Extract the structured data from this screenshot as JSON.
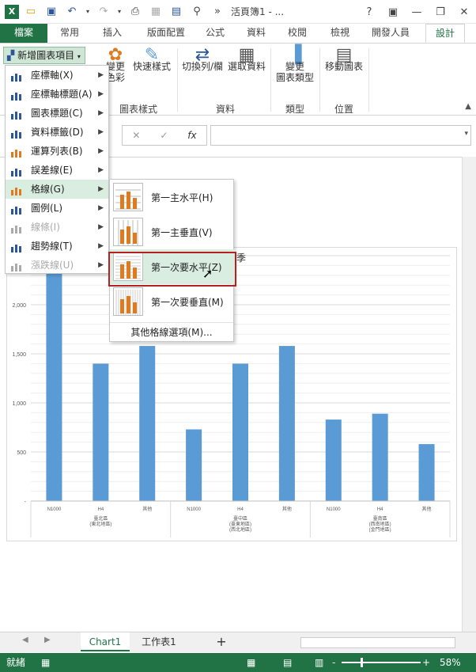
{
  "window": {
    "title": "活頁簿1 - ...",
    "help": "?",
    "min": "—",
    "restore": "❐",
    "close": "✕"
  },
  "tabs": {
    "file": "檔案",
    "home": "常用",
    "insert": "插入",
    "layout": "版面配置",
    "formulas": "公式",
    "data": "資料",
    "review": "校閱",
    "view": "檢視",
    "developer": "開發人員",
    "design": "設計"
  },
  "ribbon": {
    "add_element": "新增圖表項目",
    "change_colors": "變更\n色彩",
    "quick_styles": "快速樣式",
    "switch_row_col": "切換列/欄",
    "select_data": "選取資料",
    "change_type": "變更\n圖表類型",
    "move_chart": "移動圖表",
    "group_styles": "圖表樣式",
    "group_data": "資料",
    "group_type": "類型",
    "group_location": "位置"
  },
  "formula_bar": {
    "cancel": "✕",
    "enter": "✓",
    "fx": "fx",
    "value": ""
  },
  "menu": {
    "items": [
      {
        "label": "座標軸(X)",
        "disabled": false
      },
      {
        "label": "座標軸標題(A)",
        "disabled": false
      },
      {
        "label": "圖表標題(C)",
        "disabled": false
      },
      {
        "label": "資料標籤(D)",
        "disabled": false
      },
      {
        "label": "運算列表(B)",
        "disabled": false
      },
      {
        "label": "誤差線(E)",
        "disabled": false
      },
      {
        "label": "格線(G)",
        "disabled": false
      },
      {
        "label": "圖例(L)",
        "disabled": false
      },
      {
        "label": "線條(I)",
        "disabled": true
      },
      {
        "label": "趨勢線(T)",
        "disabled": false
      },
      {
        "label": "漲跌線(U)",
        "disabled": true
      }
    ]
  },
  "submenu": {
    "items": [
      {
        "label": "第一主水平(H)"
      },
      {
        "label": "第一主垂直(V)"
      },
      {
        "label": "第一次要水平(Z)"
      },
      {
        "label": "第一次要垂直(M)"
      }
    ],
    "more": "其他格線選項(M)..."
  },
  "chart_data": {
    "type": "bar",
    "title_fragment": "季",
    "categories": [
      "N1000",
      "H4",
      "其他",
      "N1000",
      "H4",
      "其他",
      "N1000",
      "H4",
      "其他"
    ],
    "groups": [
      {
        "label": "臺北區\n(東北地區)"
      },
      {
        "label": "臺中區\n(臺東地區)\n(西北地區)"
      },
      {
        "label": "臺南區\n(西南地區)\n(金門地區)"
      }
    ],
    "values": [
      2330,
      1400,
      1580,
      730,
      1400,
      1580,
      830,
      890,
      580
    ],
    "yticks": [
      "2,000",
      "1,500",
      "1,000",
      "500",
      "-"
    ],
    "ylim": [
      0,
      2500
    ],
    "bar_color": "#5b9bd5",
    "grid": true
  },
  "sheet_tabs": {
    "chart1": "Chart1",
    "sheet1": "工作表1",
    "add": "+"
  },
  "status": {
    "ready": "就緒",
    "zoom": "58%",
    "minus": "-",
    "plus": "+"
  }
}
